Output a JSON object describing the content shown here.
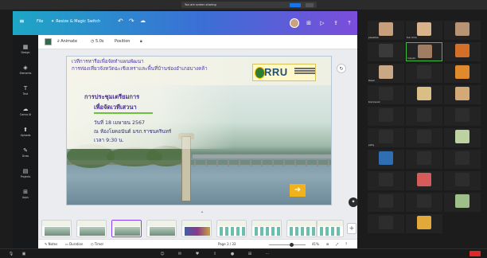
{
  "zoom": {
    "share_banner": "You are screen sharing",
    "stop_label": "Stop",
    "gallery": [
      {
        "name": "pawadee",
        "color": "#c79f7c"
      },
      {
        "name": "Kun Uma",
        "color": "#d9b38c"
      },
      {
        "name": "",
        "color": "#b89474"
      },
      {
        "name": "",
        "color": "#3a3a3a"
      },
      {
        "name": "mjoyzz",
        "color": "#a07c62"
      },
      {
        "name": "",
        "color": "#d46f2a"
      },
      {
        "name": "Rawin",
        "color": "#c9a985"
      },
      {
        "name": "",
        "color": "#2d2d2d"
      },
      {
        "name": "",
        "color": "#e08a2e"
      },
      {
        "name": "Kornkanok",
        "color": "#2d2d2d"
      },
      {
        "name": "",
        "color": "#d9bf85"
      },
      {
        "name": "",
        "color": "#d3aa77"
      },
      {
        "name": "",
        "color": "#2d2d2d"
      },
      {
        "name": "",
        "color": "#2d2d2d"
      },
      {
        "name": "",
        "color": "#2d2d2d"
      },
      {
        "name": "petty",
        "color": "#2d2d2d"
      },
      {
        "name": "",
        "color": "#2d2d2d"
      },
      {
        "name": "",
        "color": "#bcd3a1"
      },
      {
        "name": "",
        "color": "#2f6eb3"
      },
      {
        "name": "",
        "color": "#2d2d2d"
      },
      {
        "name": "",
        "color": "#2d2d2d"
      },
      {
        "name": "",
        "color": "#2d2d2d"
      },
      {
        "name": "",
        "color": "#d65c5c"
      },
      {
        "name": "",
        "color": "#2d2d2d"
      },
      {
        "name": "",
        "color": "#2d2d2d"
      },
      {
        "name": "",
        "color": "#2d2d2d"
      },
      {
        "name": "",
        "color": "#9fbf8a"
      },
      {
        "name": "",
        "color": "#2d2d2d"
      },
      {
        "name": "",
        "color": "#e3a83a"
      }
    ]
  },
  "canva": {
    "file_label": "File",
    "resize_label": "Resize & Magic Switch",
    "toolbar": {
      "animate": "Animate",
      "duration": "5.0s",
      "position": "Position"
    },
    "sidebar": [
      {
        "icon": "▦",
        "label": "Design"
      },
      {
        "icon": "◈",
        "label": "Elements"
      },
      {
        "icon": "T",
        "label": "Text"
      },
      {
        "icon": "☁",
        "label": "Canva AI"
      },
      {
        "icon": "⬆",
        "label": "Uploads"
      },
      {
        "icon": "✎",
        "label": "Draw"
      },
      {
        "icon": "▤",
        "label": "Projects"
      },
      {
        "icon": "⊞",
        "label": "Apps"
      }
    ],
    "slide": {
      "headline_line1": "เวทีการหารือเพื่อจัดทำแผนพัฒนา",
      "headline_line2": "การท่องเที่ยวจังหวัดฉะเชิงเทราและพื้นที่บ้านช่องอำเภอบางคล้า",
      "logo": "RRU",
      "title_line1": "การประชุมเตรียมการ",
      "title_line2": "เพื่อจัดเวทีเสวนา",
      "date": "วันที่ 18 เมษายน 2567",
      "venue": "ณ ห้องโยคอนันต์ มรภ.ราชนครินทร์",
      "time": "เวลา 9:30 น."
    },
    "bottom": {
      "notes": "Notes",
      "duration": "Duration",
      "timer": "Timer",
      "page": "Page 3 / 33",
      "zoom": "41%"
    }
  }
}
